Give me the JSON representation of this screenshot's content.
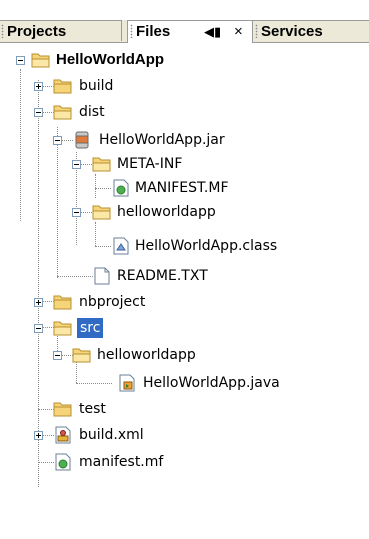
{
  "tabs": {
    "projects": "Projects",
    "files": "Files",
    "services": "Services",
    "minimize": "◀▮",
    "close": "×"
  },
  "tree": {
    "root": "HelloWorldApp",
    "build": "build",
    "dist": "dist",
    "jar": "HelloWorldApp.jar",
    "meta_inf": "META-INF",
    "manifest_upper": "MANIFEST.MF",
    "helloworldapp_dist": "helloworldapp",
    "class_file": "HelloWorldApp.class",
    "readme": "README.TXT",
    "nbproject": "nbproject",
    "src": "src",
    "helloworldapp_src": "helloworldapp",
    "java_file": "HelloWorldApp.java",
    "test": "test",
    "build_xml": "build.xml",
    "manifest_lower": "manifest.mf"
  },
  "colors": {
    "selection": "#316ac5",
    "tab_bg": "#ece9d8",
    "folder": "#f6d57a",
    "folder_edge": "#b8902e"
  }
}
